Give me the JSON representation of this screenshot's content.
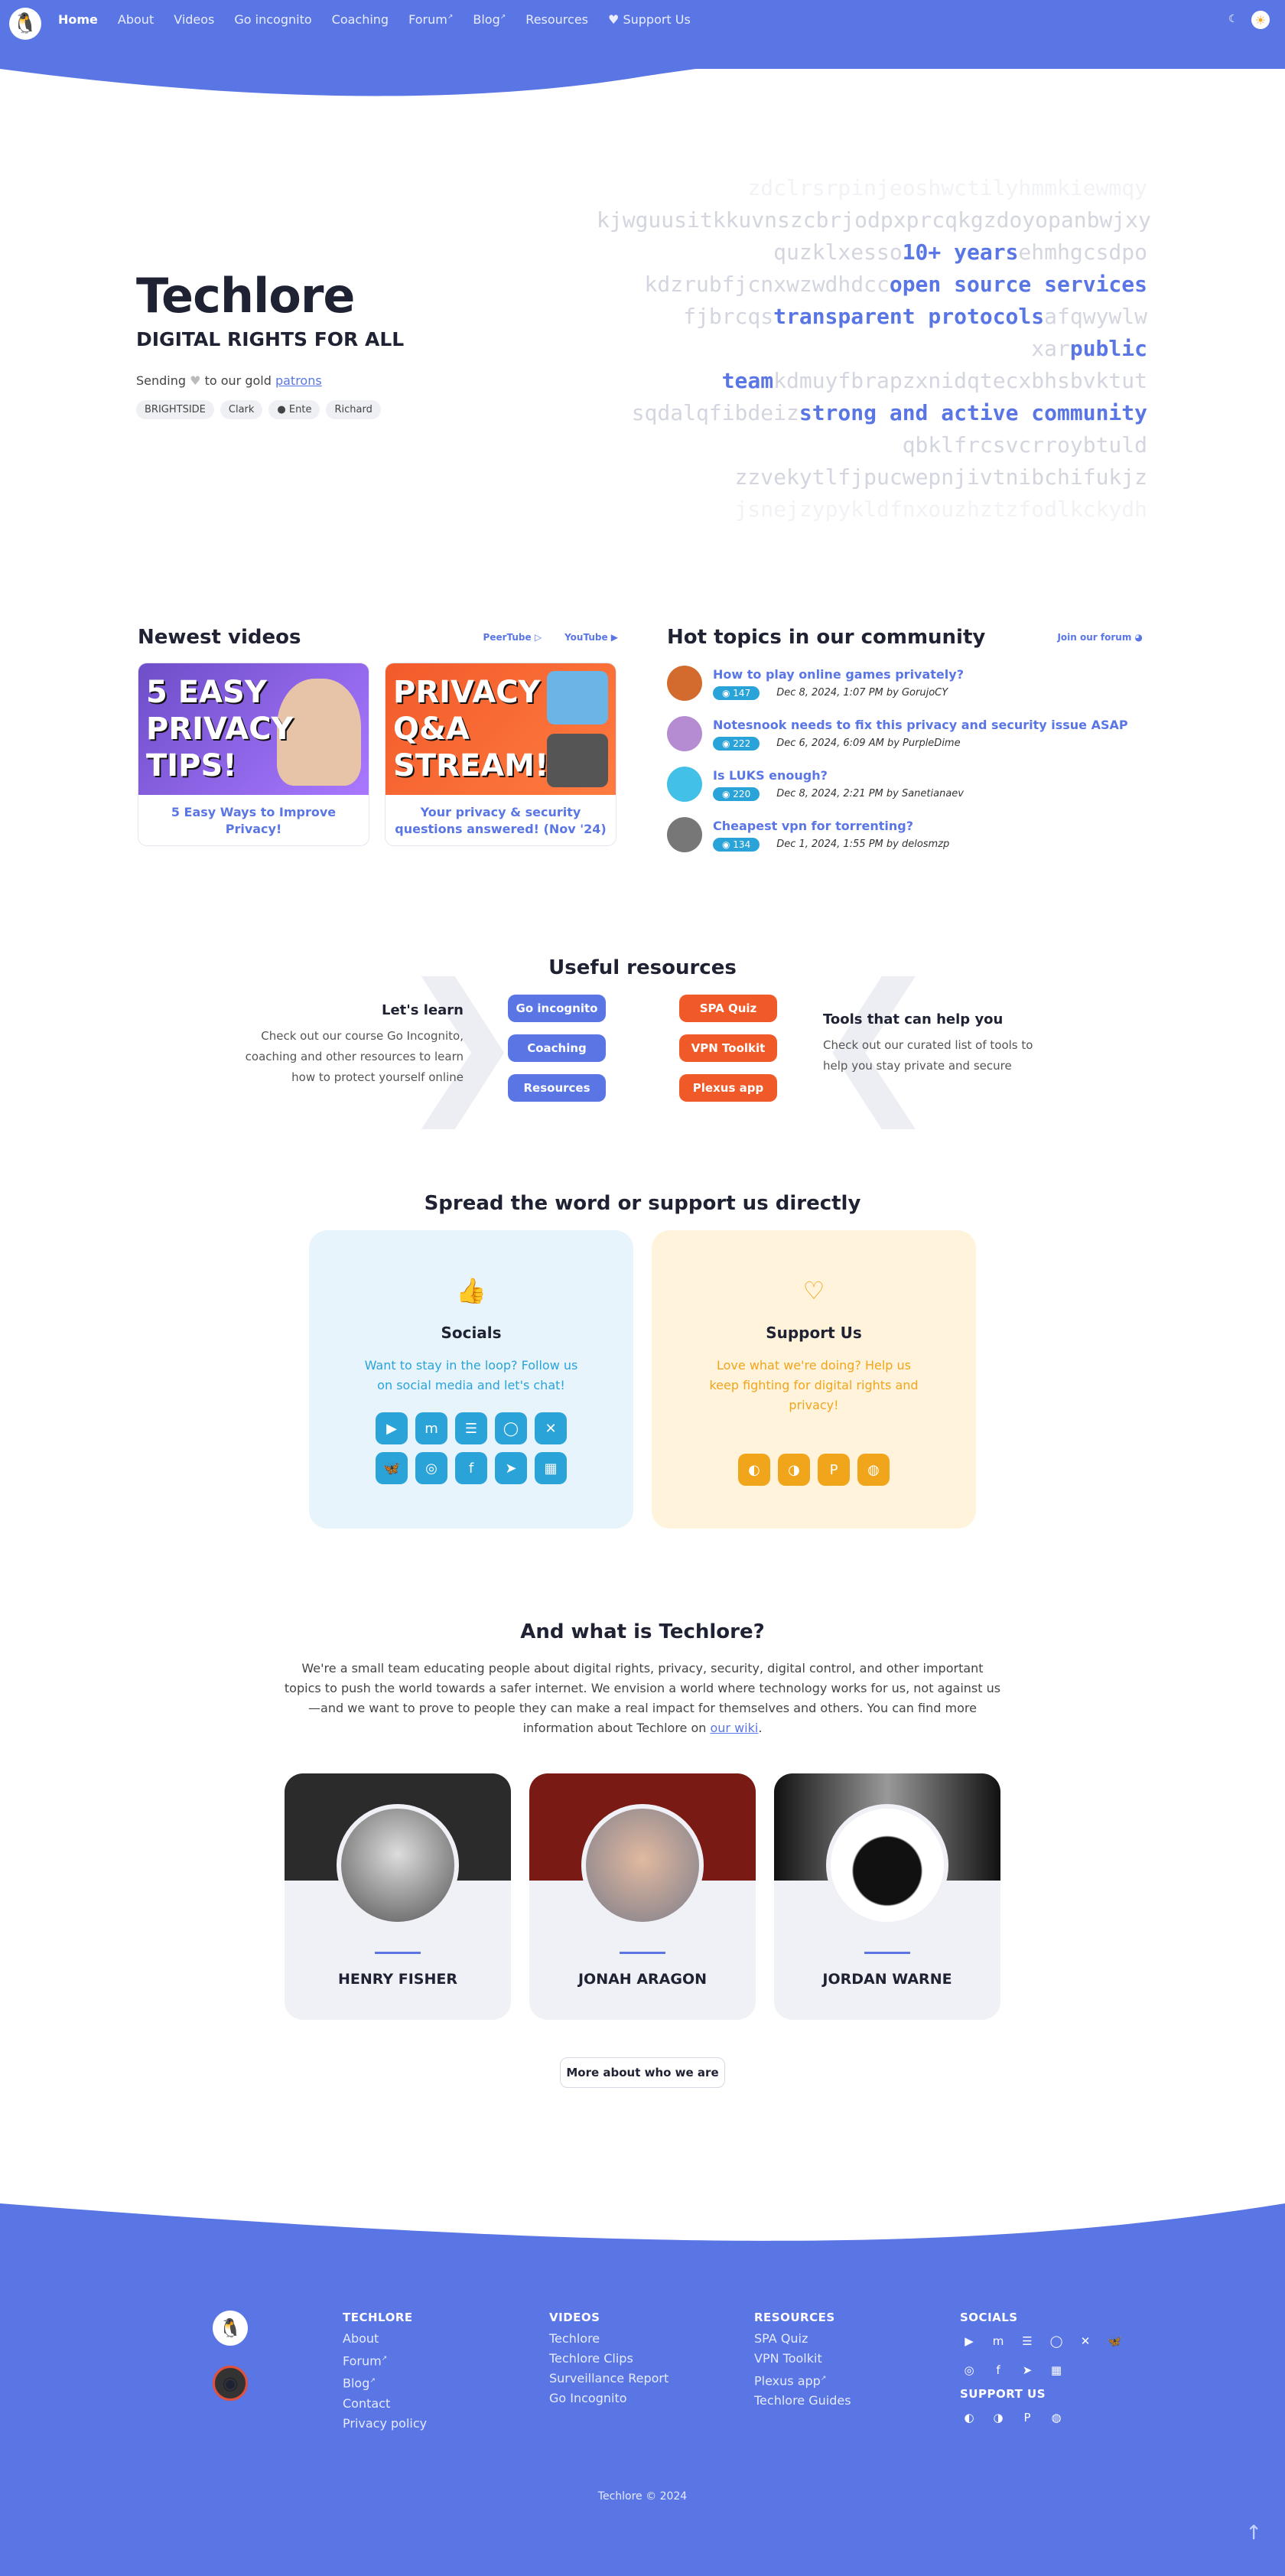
{
  "nav": {
    "items": [
      "Home",
      "About",
      "Videos",
      "Go incognito",
      "Coaching",
      "Forum",
      "Blog",
      "Resources",
      "Support Us"
    ],
    "external_marker": "↗"
  },
  "hero": {
    "title": "Techlore",
    "subtitle": "DIGITAL RIGHTS FOR ALL",
    "sending_pre": "Sending",
    "sending_mid": "to our gold",
    "sending_link": "patrons",
    "patrons": [
      "BRIGHTSIDE",
      "Clark",
      "Ente",
      "Richard"
    ],
    "code_lines": [
      {
        "plain": "zdclrsrpinjeoshwctilyhmmkiewmqy",
        "hl": "",
        "after": ""
      },
      {
        "plain": "kjwguusitkkuvnszcbrjodpxprcqkgzdoyopanbwjxy",
        "hl": "",
        "after": ""
      },
      {
        "plain": "quzklxesso",
        "hl": "10+ years",
        "after": "ehmhgcsdpo"
      },
      {
        "plain": "kdzrubfjcnxwzwdhdcc",
        "hl": "open source services",
        "after": ""
      },
      {
        "plain": "fjbrcqs",
        "hl": "transparent protocols",
        "after": "afqwywlw"
      },
      {
        "plain": "xar",
        "hl": "public team",
        "after": "kdmuyfbrapzxnidqtecxbhsbvktut"
      },
      {
        "plain": "sqdalqfibdeiz",
        "hl": "strong and active community",
        "after": ""
      },
      {
        "plain": "qbklfrcsvcrroybtuld zzvekytlfjpucwepnjivtnibchifukjz",
        "hl": "",
        "after": ""
      },
      {
        "plain": "jsnejzypykldfnxouzhztzfodlkckydh",
        "hl": "",
        "after": ""
      }
    ]
  },
  "videos": {
    "heading": "Newest videos",
    "link_peertube": "PeerTube ▷",
    "link_youtube": "YouTube ▶",
    "items": [
      {
        "thumb_text": "5 EASY PRIVACY TIPS!",
        "caption": "5 Easy Ways to Improve Privacy!"
      },
      {
        "thumb_text": "PRIVACY Q&A STREAM!",
        "caption": "Your privacy & security questions answered! (Nov '24)"
      }
    ]
  },
  "topics": {
    "heading": "Hot topics in our community",
    "join_link": "Join our forum",
    "items": [
      {
        "title": "How to play online games privately?",
        "views": "147",
        "date": "Dec 8, 2024, 1:07 PM by GorujoCY",
        "color": "#d36b2f"
      },
      {
        "title": "Notesnook needs to fix this privacy and security issue ASAP",
        "views": "222",
        "date": "Dec 6, 2024, 6:09 AM by PurpleDime",
        "color": "#b58bd1"
      },
      {
        "title": "Is LUKS enough?",
        "views": "220",
        "date": "Dec 8, 2024, 2:21 PM by Sanetianaev",
        "color": "#42c0e8"
      },
      {
        "title": "Cheapest vpn for torrenting?",
        "views": "134",
        "date": "Dec 1, 2024, 1:55 PM by delosmzp",
        "color": "#777"
      }
    ]
  },
  "resources": {
    "heading": "Useful resources",
    "left_title": "Let's learn",
    "left_text": "Check out our course Go Incognito, coaching and other resources to learn how to protect yourself online",
    "right_title": "Tools that can help you",
    "right_text": "Check out our curated list of tools to help you stay private and secure",
    "blue_buttons": [
      "Go incognito",
      "Coaching",
      "Resources"
    ],
    "orange_buttons": [
      "SPA Quiz",
      "VPN Toolkit",
      "Plexus app"
    ]
  },
  "spread": {
    "heading": "Spread the word or support us directly",
    "socials_title": "Socials",
    "socials_text": "Want to stay in the loop? Follow us on social media and let's chat!",
    "support_title": "Support Us",
    "support_text": "Love what we're doing? Help us keep fighting for digital rights and privacy!",
    "social_icons": [
      "youtube-icon",
      "mastodon-icon",
      "rss-icon",
      "signal-icon",
      "x-icon",
      "bluesky-icon",
      "instagram-icon",
      "facebook-icon",
      "telegram-icon",
      "matrix-icon"
    ],
    "support_icons": [
      "patreon-icon",
      "ko-fi-icon",
      "paypal-icon",
      "crypto-icon"
    ]
  },
  "about": {
    "heading": "And what is Techlore?",
    "text": "We're a small team educating people about digital rights, privacy, security, digital control, and other important topics to push the world towards a safer internet. We envision a world where technology works for us, not against us—and we want to prove to people they can make a real impact for themselves and others. You can find more information about Techlore on",
    "link": "our wiki",
    "team": [
      "HENRY FISHER",
      "JONAH ARAGON",
      "JORDAN WARNE"
    ],
    "more_button": "More about who we are"
  },
  "footer": {
    "col1_title": "TECHLORE",
    "col1": [
      "About",
      "Forum",
      "Blog",
      "Contact",
      "Privacy policy"
    ],
    "col2_title": "VIDEOS",
    "col2": [
      "Techlore",
      "Techlore Clips",
      "Surveillance Report",
      "Go Incognito"
    ],
    "col3_title": "RESOURCES",
    "col3": [
      "SPA Quiz",
      "VPN Toolkit",
      "Plexus app",
      "Techlore Guides"
    ],
    "socials_title": "SOCIALS",
    "support_title": "SUPPORT US",
    "copyright": "Techlore © 2024"
  },
  "colors": {
    "brand": "#5a76e5",
    "accent_orange": "#f05a28",
    "social_blue": "#2aa3d9",
    "support_gold": "#f0a51b"
  }
}
